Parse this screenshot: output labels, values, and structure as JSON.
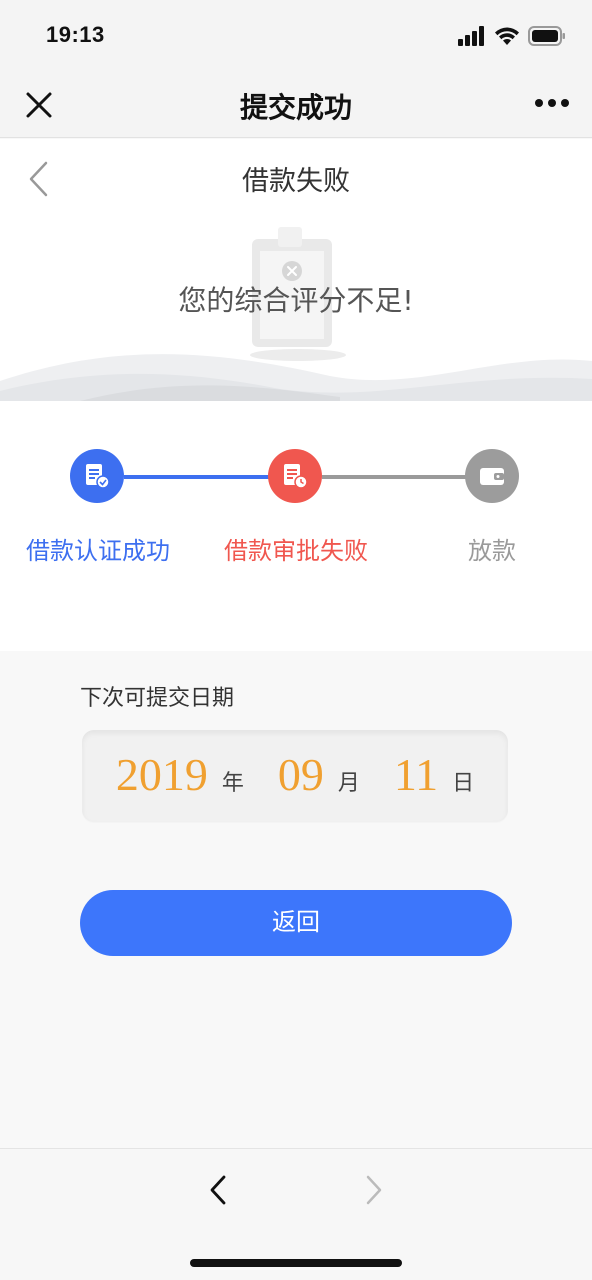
{
  "status": {
    "time": "19:13"
  },
  "wechat_bar": {
    "title": "提交成功"
  },
  "page": {
    "title": "借款失败",
    "message": "您的综合评分不足!"
  },
  "steps": [
    {
      "label": "借款认证成功",
      "state": "done",
      "color": "#3d6ff0"
    },
    {
      "label": "借款审批失败",
      "state": "failed",
      "color": "#f0574f"
    },
    {
      "label": "放款",
      "state": "pending",
      "color": "#9c9c9c"
    }
  ],
  "next_submit": {
    "label": "下次可提交日期",
    "year": "2019",
    "year_unit": "年",
    "month": "09",
    "month_unit": "月",
    "day": "11",
    "day_unit": "日"
  },
  "actions": {
    "return_label": "返回"
  },
  "icons": [
    "close-icon",
    "more-icon",
    "back-arrow-icon",
    "doc-check-icon",
    "doc-clock-icon",
    "wallet-icon",
    "nav-back-icon",
    "nav-forward-icon"
  ]
}
